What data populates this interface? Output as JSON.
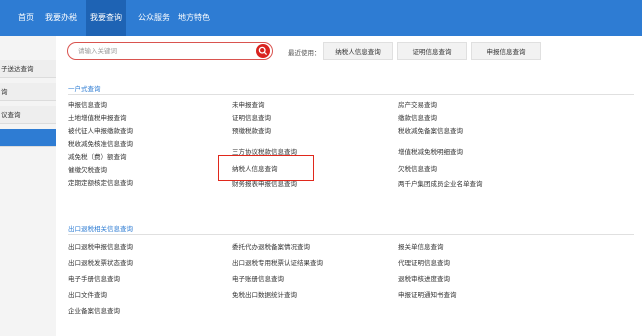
{
  "topnav": {
    "items": [
      {
        "label": "首页"
      },
      {
        "label": "我要办税"
      },
      {
        "label": "我要查询"
      },
      {
        "label": "公众服务"
      },
      {
        "label": "地方特色"
      }
    ]
  },
  "sidebar": {
    "items": [
      {
        "label": "子送达查询"
      },
      {
        "label": "询"
      },
      {
        "label": "议查询"
      },
      {
        "label": ""
      }
    ]
  },
  "search": {
    "placeholder": "请输入关键词",
    "button_icon": "search-icon"
  },
  "recent": {
    "label": "最近使用：",
    "items": [
      "纳税人信息查询",
      "证明信息查询",
      "申报信息查询"
    ]
  },
  "section1": {
    "title": "一户式查询",
    "col1": [
      "申报信息查询",
      "土地增值税申报查询",
      "被代征人申报缴款查询",
      "税收减免核准信息查询",
      "减免税（费）额查询",
      "催缴欠税查询",
      "定期定额核定信息查询"
    ],
    "col2": [
      "未申报查询",
      "证明信息查询",
      "预缴税款查询",
      "三方协议税款信息查询",
      "纳税人信息查询",
      "财务报表申报信息查询"
    ],
    "col3": [
      "房产交易查询",
      "缴款信息查询",
      "税收减免备案信息查询",
      "增值税减免税明细查询",
      "欠税信息查询",
      "两千户集团成员企业名单查询"
    ]
  },
  "section2": {
    "title": "出口退税相关信息查询",
    "col1": [
      "出口退税申报信息查询",
      "出口退税发票状态查询",
      "电子手册信息查询",
      "出口文件查询",
      "企业备案信息查询"
    ],
    "col2": [
      "委托代办退税备案情况查询",
      "出口退税专用税票认证结果查询",
      "电子账册信息查询",
      "免税出口数据统计查询"
    ],
    "col3": [
      "报关单信息查询",
      "代理证明信息查询",
      "退税审核进度查询",
      "申报证明通知书查询"
    ]
  },
  "colors": {
    "primary": "#2e7cd3",
    "highlight": "#e0281c"
  }
}
